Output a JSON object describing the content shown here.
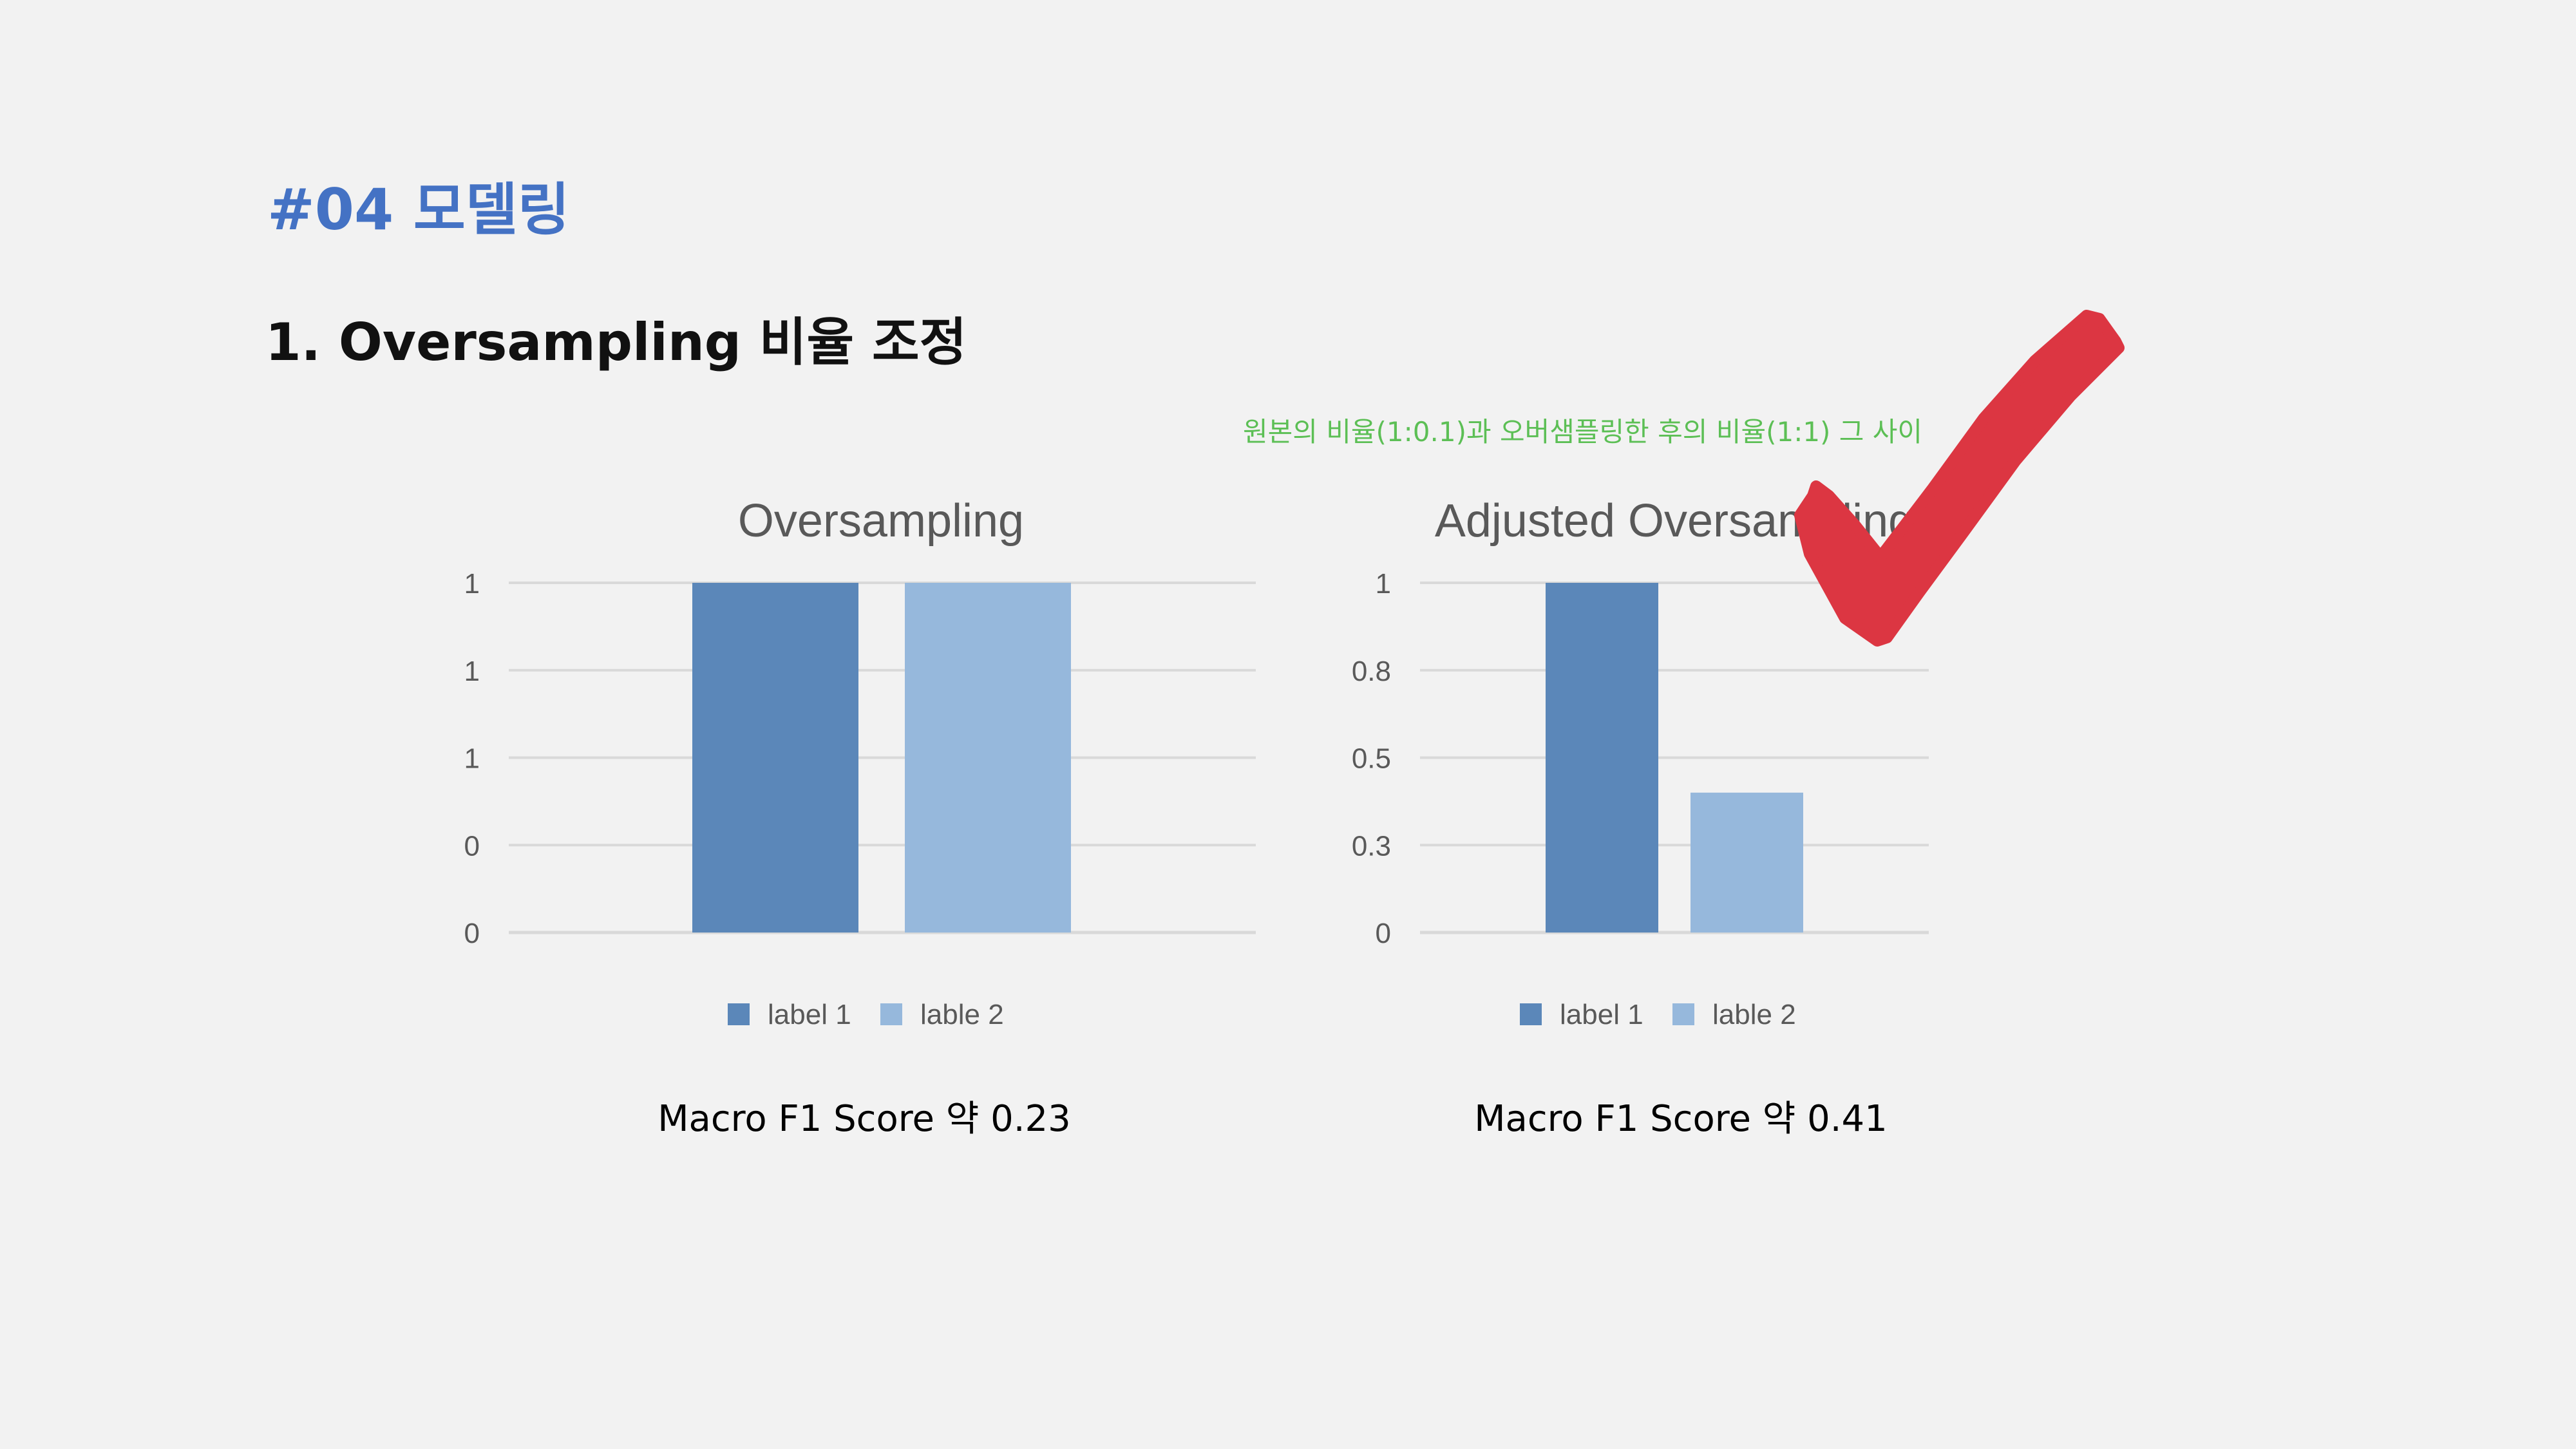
{
  "slide": {
    "section_title": "#04 모델링",
    "subtitle": "1. Oversampling 비율 조정",
    "note": "원본의 비율(1:0.1)과 오버샘플링한 후의 비율(1:1) 그 사이",
    "captions": [
      "Macro F1 Score 약 0.23",
      "Macro F1 Score 약 0.41"
    ]
  },
  "colors": {
    "series_1": "#5b87b9",
    "series_2": "#96b8dc",
    "grid": "#d9d9d9",
    "tick_text": "#595959",
    "checkmark": "#dc3642"
  },
  "icons": {
    "checkmark": "checkmark-icon"
  },
  "chart_data": [
    {
      "type": "bar",
      "title": "Oversampling",
      "categories": [
        ""
      ],
      "series": [
        {
          "name": "label 1",
          "values": [
            1
          ]
        },
        {
          "name": "lable 2",
          "values": [
            1
          ]
        }
      ],
      "ylim": [
        0,
        1
      ],
      "yticks": [
        0,
        0.25,
        0.5,
        0.75,
        1
      ],
      "ytick_labels": [
        "0",
        "0",
        "1",
        "1",
        "1"
      ],
      "grid": true,
      "legend": "bottom"
    },
    {
      "type": "bar",
      "title": "Adjusted Oversampling",
      "categories": [
        ""
      ],
      "series": [
        {
          "name": "label 1",
          "values": [
            1
          ]
        },
        {
          "name": "lable 2",
          "values": [
            0.4
          ]
        }
      ],
      "ylim": [
        0,
        1
      ],
      "yticks": [
        0,
        0.25,
        0.5,
        0.75,
        1
      ],
      "ytick_labels": [
        "0",
        "0.3",
        "0.5",
        "0.8",
        "1"
      ],
      "grid": true,
      "legend": "bottom"
    }
  ]
}
